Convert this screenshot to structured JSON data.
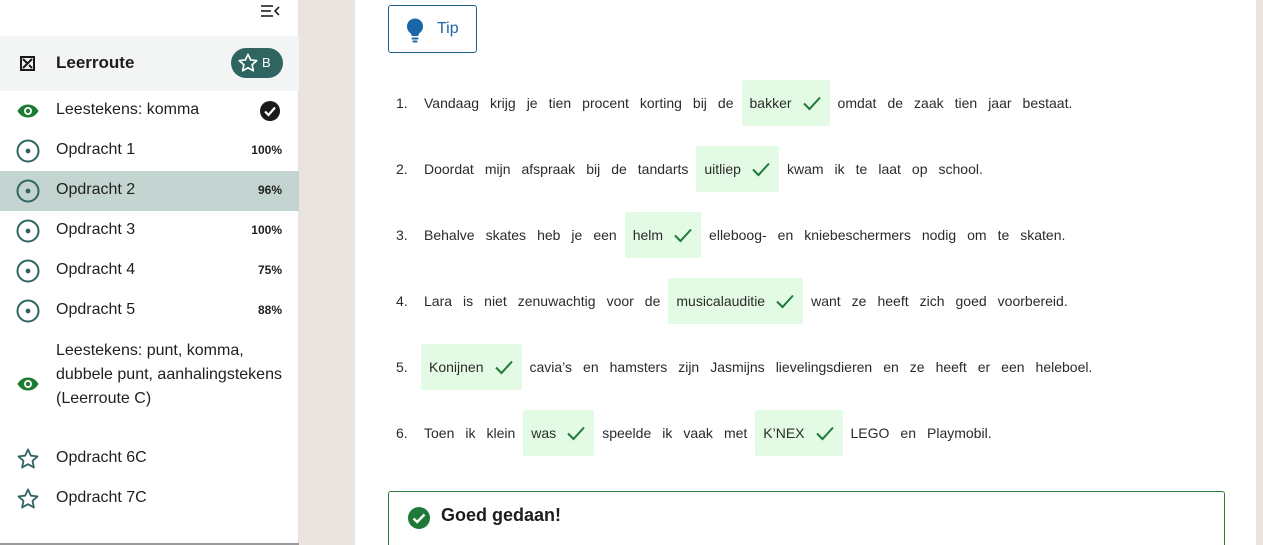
{
  "sidebar": {
    "header": {
      "title": "Leerroute",
      "badge": "B"
    },
    "items": [
      {
        "label": "Leestekens: komma",
        "icon": "eye-icon"
      },
      {
        "label": "Opdracht 1",
        "pct": "100%",
        "icon": "target-icon"
      },
      {
        "label": "Opdracht 2",
        "pct": "96%",
        "icon": "target-icon",
        "active": true
      },
      {
        "label": "Opdracht 3",
        "pct": "100%",
        "icon": "target-icon"
      },
      {
        "label": "Opdracht 4",
        "pct": "75%",
        "icon": "target-icon"
      },
      {
        "label": "Opdracht 5",
        "pct": "88%",
        "icon": "target-icon"
      },
      {
        "label": "Leestekens: punt, komma, dubbele punt, aanhalingstekens (Leerroute C)",
        "icon": "eye-icon"
      },
      {
        "label": "Opdracht 6C",
        "icon": "star-icon"
      },
      {
        "label": "Opdracht 7C",
        "icon": "star-icon"
      }
    ]
  },
  "tip": {
    "label": "Tip"
  },
  "sentences": [
    {
      "num": "1.",
      "parts": [
        "Vandaag",
        "krijg",
        "je",
        "tien",
        "procent",
        "korting",
        "bij",
        "de",
        {
          "gap": "bakker"
        },
        "omdat",
        "de",
        "zaak",
        "tien",
        "jaar",
        "bestaat."
      ]
    },
    {
      "num": "2.",
      "parts": [
        "Doordat",
        "mijn",
        "afspraak",
        "bij",
        "de",
        "tandarts",
        {
          "gap": "uitliep"
        },
        "kwam",
        "ik",
        "te",
        "laat",
        "op",
        "school."
      ]
    },
    {
      "num": "3.",
      "parts": [
        "Behalve",
        "skates",
        "heb",
        "je",
        "een",
        {
          "gap": "helm"
        },
        "elleboog-",
        "en",
        "kniebeschermers",
        "nodig",
        "om",
        "te",
        "skaten."
      ]
    },
    {
      "num": "4.",
      "parts": [
        "Lara",
        "is",
        "niet",
        "zenuwachtig",
        "voor",
        "de",
        {
          "gap": "musicalauditie"
        },
        "want",
        "ze",
        "heeft",
        "zich",
        "goed",
        "voorbereid."
      ]
    },
    {
      "num": "5.",
      "parts": [
        {
          "gap": "Konijnen"
        },
        "cavia’s",
        "en",
        "hamsters",
        "zijn",
        "Jasmijns",
        "lievelingsdieren",
        "en",
        "ze",
        "heeft",
        "er",
        "een",
        "heleboel."
      ]
    },
    {
      "num": "6.",
      "parts": [
        "Toen",
        "ik",
        "klein",
        {
          "gap": "was"
        },
        "speelde",
        "ik",
        "vaak",
        "met",
        {
          "gap": "K’NEX"
        },
        "LEGO",
        "en",
        "Playmobil."
      ]
    }
  ],
  "feedback": {
    "text": "Goed gedaan!"
  },
  "colors": {
    "accent": "#2f6461",
    "correct_bg": "#e3fbe4",
    "correct_check": "#1f7a3a",
    "tip_blue": "#1a66a8",
    "active_item": "#c3d4d1"
  }
}
